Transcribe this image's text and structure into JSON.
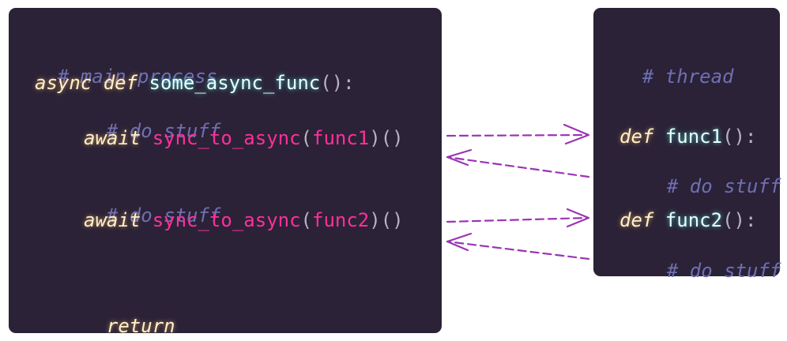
{
  "main_process": {
    "comment": "# main process",
    "def_keyword": "async def",
    "func_name": "some_async_func",
    "func_parens": "():",
    "body_comment_1": "# do stuff",
    "await_1": "await",
    "call_1": "sync_to_async",
    "open_1": "(",
    "arg_1": "func1",
    "close_1": ")()",
    "body_comment_2": "# do stuff",
    "await_2": "await",
    "call_2": "sync_to_async",
    "open_2": "(",
    "arg_2": "func2",
    "close_2": ")()",
    "return_keyword": "return"
  },
  "thread": {
    "comment": "# thread",
    "def_1": "def",
    "func1_name": "func1",
    "func1_parens": "():",
    "func1_body": "# do stuff",
    "def_2": "def",
    "func2_name": "func2",
    "func2_parens": "():",
    "func2_body": "# do stuff"
  },
  "colors": {
    "panel_background": "#2b2237",
    "comment": "#6f6fb3",
    "keyword": "#fff0c8",
    "function_name": "#e9fffc",
    "call": "#ff2f9b",
    "punctuation": "#b8b3c2",
    "arrow": "#9b34b4"
  }
}
